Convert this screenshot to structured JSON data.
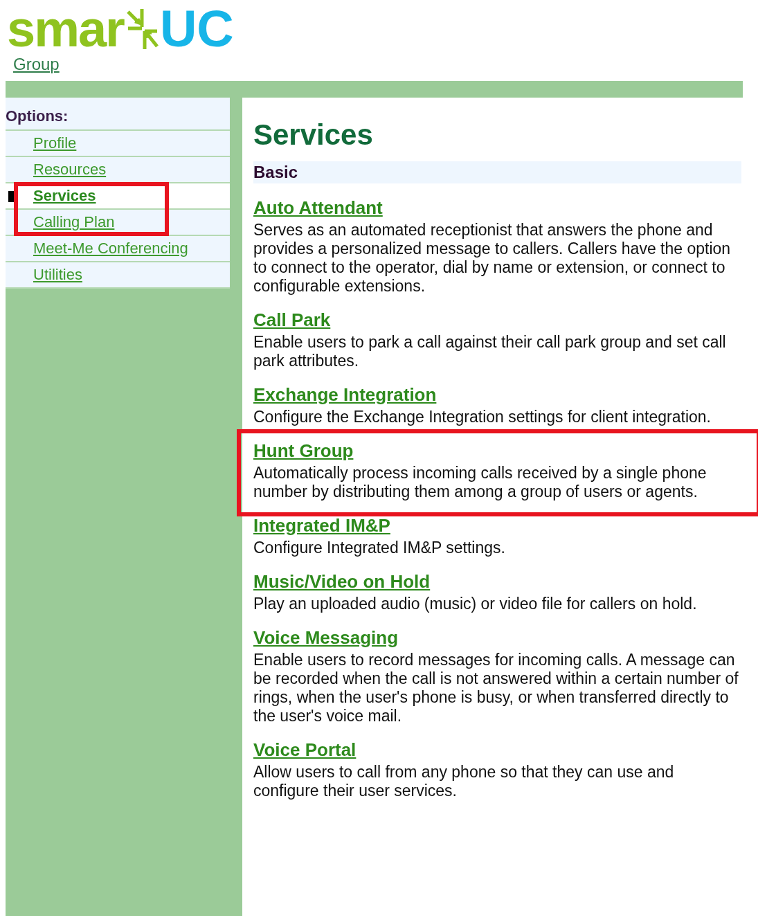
{
  "logo": {
    "word_left": "smar",
    "word_right": "UC"
  },
  "breadcrumb": "Group",
  "sidebar": {
    "heading": "Options:",
    "items": [
      {
        "label": "Profile",
        "selected": false
      },
      {
        "label": "Resources",
        "selected": false
      },
      {
        "label": "Services",
        "selected": true
      },
      {
        "label": "Calling Plan",
        "selected": false
      },
      {
        "label": "Meet-Me Conferencing",
        "selected": false
      },
      {
        "label": "Utilities",
        "selected": false
      }
    ]
  },
  "content": {
    "title": "Services",
    "section": "Basic",
    "services": [
      {
        "name": "Auto Attendant",
        "description": "Serves as an automated receptionist that answers the phone and provides a personalized message to callers. Callers have the option to connect to the operator, dial by name or extension, or connect to configurable extensions.",
        "highlighted": false
      },
      {
        "name": "Call Park",
        "description": "Enable users to park a call against their call park group and set call park attributes.",
        "highlighted": false
      },
      {
        "name": "Exchange Integration",
        "description": "Configure the Exchange Integration settings for client integration.",
        "highlighted": false
      },
      {
        "name": "Hunt Group",
        "description": "Automatically process incoming calls received by a single phone number by distributing them among a group of users or agents.",
        "highlighted": true
      },
      {
        "name": "Integrated IM&P",
        "description": "Configure Integrated IM&P settings.",
        "highlighted": false
      },
      {
        "name": "Music/Video on Hold",
        "description": "Play an uploaded audio (music) or video file for callers on hold.",
        "highlighted": false
      },
      {
        "name": "Voice Messaging",
        "description": "Enable users to record messages for incoming calls. A message can be recorded when the call is not answered within a certain number of rings, when the user's phone is busy, or when transferred directly to the user's voice mail.",
        "highlighted": false
      },
      {
        "name": "Voice Portal",
        "description": "Allow users to call from any phone so that they can use and configure their user services.",
        "highlighted": false
      }
    ]
  }
}
